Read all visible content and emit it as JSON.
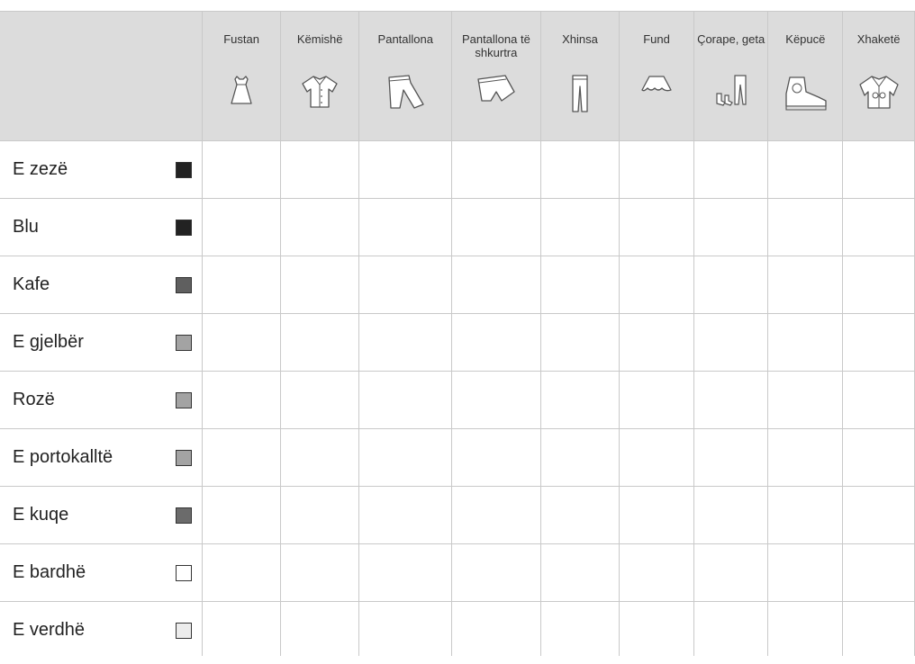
{
  "columns": [
    {
      "label": "Fustan",
      "icon": "dress-icon"
    },
    {
      "label": "Këmishë",
      "icon": "shirt-icon"
    },
    {
      "label": "Pantallona",
      "icon": "pants-icon"
    },
    {
      "label": "Pantallona të shkurtra",
      "icon": "shorts-icon"
    },
    {
      "label": "Xhinsa",
      "icon": "jeans-icon"
    },
    {
      "label": "Fund",
      "icon": "skirt-icon"
    },
    {
      "label": "Çorape, geta",
      "icon": "socks-tights-icon"
    },
    {
      "label": "Këpucë",
      "icon": "shoe-icon"
    },
    {
      "label": "Xhaketë",
      "icon": "jacket-icon"
    }
  ],
  "rows": [
    {
      "label": "E zezë",
      "swatch": "#222222"
    },
    {
      "label": "Blu",
      "swatch": "#222222"
    },
    {
      "label": "Kafe",
      "swatch": "#5f5f5f"
    },
    {
      "label": "E gjelbër",
      "swatch": "#a3a3a3"
    },
    {
      "label": "Rozë",
      "swatch": "#a3a3a3"
    },
    {
      "label": "E portokalltë",
      "swatch": "#a3a3a3"
    },
    {
      "label": "E kuqe",
      "swatch": "#6b6b6b"
    },
    {
      "label": "E bardhë",
      "swatch": "#ffffff"
    },
    {
      "label": "E verdhë",
      "swatch": "#ececec"
    }
  ],
  "colors": {
    "header_bg": "#dcdcdc",
    "grid_line": "#c9c9c9"
  }
}
